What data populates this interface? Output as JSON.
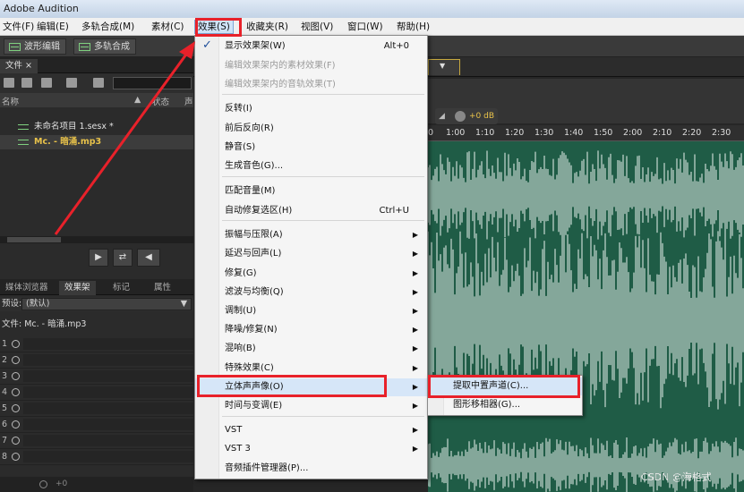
{
  "window": {
    "title": "Adobe Audition"
  },
  "menubar": {
    "items": [
      "文件(F)",
      "编辑(E)",
      "多轨合成(M)",
      "素材(C)",
      "效果(S)",
      "收藏夹(R)",
      "视图(V)",
      "窗口(W)",
      "帮助(H)"
    ],
    "active": "效果(S)"
  },
  "toolbar": {
    "waveform_label": "波形编辑",
    "multitrack_label": "多轨合成"
  },
  "files_panel": {
    "tab": "文件",
    "col_name": "名称",
    "col_status": "状态",
    "col_more": "声",
    "rows": [
      "未命名项目 1.sesx *",
      "Mc. - 暗涌.mp3"
    ]
  },
  "transport": {
    "play": "▶",
    "loop": "⇄",
    "export": "◀"
  },
  "lower_panel": {
    "tabs": [
      "媒体浏览器",
      "效果架",
      "标记",
      "属性"
    ],
    "preset_label": "预设:",
    "preset_value": "(默认)",
    "file_label": "文件: Mc. - 暗涌.mp3",
    "slots": [
      "1",
      "2",
      "3",
      "4",
      "5",
      "6",
      "7",
      "8"
    ],
    "status_value": "+0"
  },
  "editor": {
    "ruler_ticks": [
      "0",
      "1:00",
      "1:10",
      "1:20",
      "1:30",
      "1:40",
      "1:50",
      "2:00",
      "2:10",
      "2:20",
      "2:30"
    ],
    "hud_value": "+0 dB",
    "wave_color": "#1f5c46"
  },
  "effects_menu": {
    "items": [
      {
        "label": "显示效果架(W)",
        "shortcut": "Alt+0",
        "checked": true
      },
      {
        "label": "编辑效果架内的素材效果(F)",
        "disabled": true
      },
      {
        "label": "编辑效果架内的音轨效果(T)",
        "disabled": true
      },
      {
        "label": "反转(I)"
      },
      {
        "label": "前后反向(R)"
      },
      {
        "label": "静音(S)"
      },
      {
        "label": "生成音色(G)..."
      },
      {
        "label": "匹配音量(M)"
      },
      {
        "label": "自动修复选区(H)",
        "shortcut": "Ctrl+U"
      },
      {
        "label": "振幅与压限(A)",
        "submenu": true
      },
      {
        "label": "延迟与回声(L)",
        "submenu": true
      },
      {
        "label": "修复(G)",
        "submenu": true
      },
      {
        "label": "滤波与均衡(Q)",
        "submenu": true
      },
      {
        "label": "调制(U)",
        "submenu": true
      },
      {
        "label": "降噪/修复(N)",
        "submenu": true
      },
      {
        "label": "混响(B)",
        "submenu": true
      },
      {
        "label": "特殊效果(C)",
        "submenu": true
      },
      {
        "label": "立体声声像(O)",
        "submenu": true,
        "highlighted": true
      },
      {
        "label": "时间与变调(E)",
        "submenu": true
      },
      {
        "label": "VST",
        "submenu": true
      },
      {
        "label": "VST 3",
        "submenu": true
      },
      {
        "label": "音频插件管理器(P)..."
      }
    ]
  },
  "stereo_submenu": {
    "items": [
      "提取中置声道(C)...",
      "图形移相器(G)..."
    ]
  },
  "annotations": {
    "highlight_color": "#e8212a"
  },
  "watermark": "CSDN @海格式"
}
